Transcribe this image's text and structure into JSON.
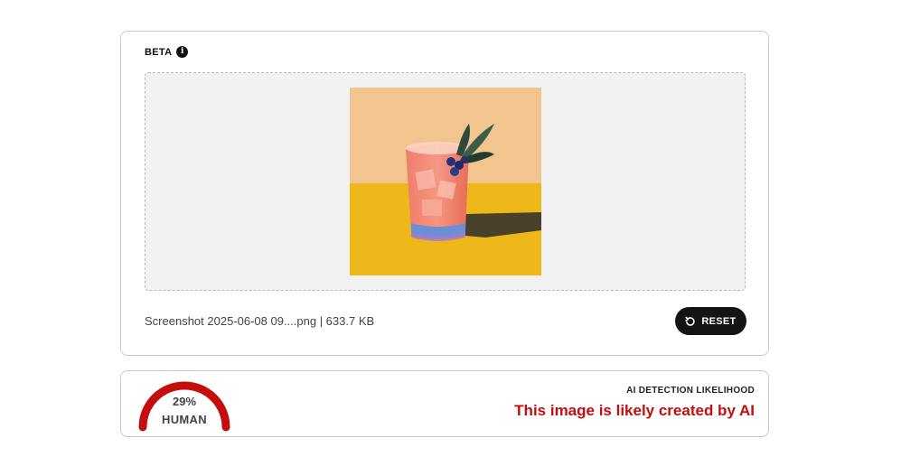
{
  "upload": {
    "beta_label": "BETA",
    "info_icon": "info-icon",
    "preview_image": "cocktail-glass-painting",
    "file_info": "Screenshot 2025-06-08 09....png | 633.7 KB",
    "reset_label": "RESET",
    "reset_icon": "rotate-ccw-icon"
  },
  "result": {
    "gauge_value": "29%",
    "gauge_label": "HUMAN",
    "human_fraction": 0.29,
    "likelihood_label": "AI DETECTION LIKELIHOOD",
    "verdict": "This image is likely created by AI",
    "verdict_color": "#c40d0d"
  }
}
